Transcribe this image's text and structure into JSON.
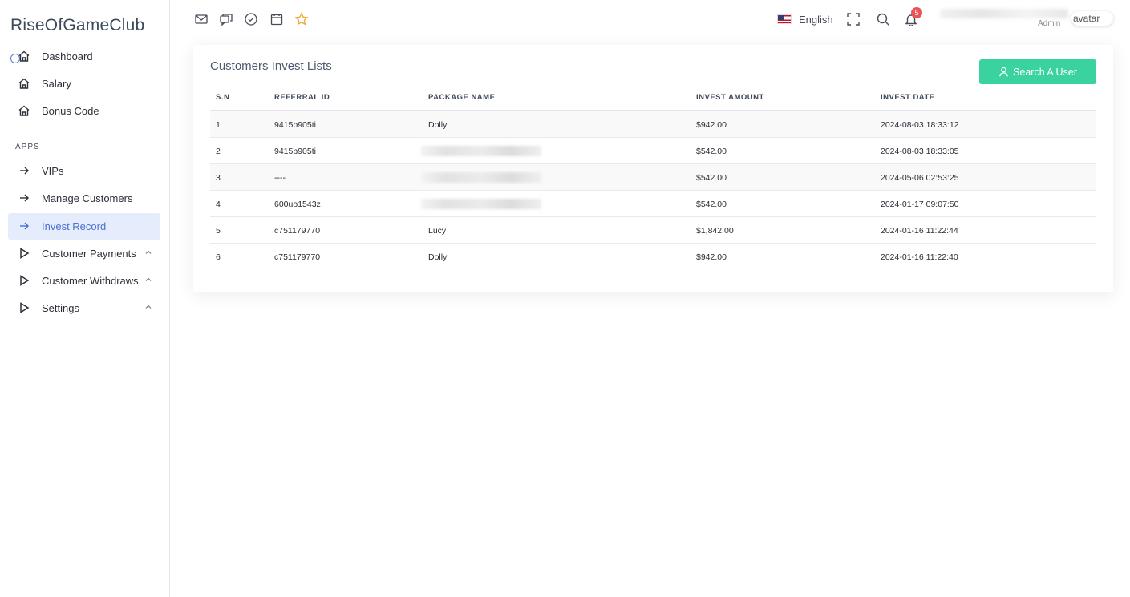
{
  "app": {
    "brand": "RiseOfGameClub"
  },
  "sidebar": {
    "section_label": "APPS",
    "items": [
      {
        "label": "Dashboard",
        "icon": "home-icon"
      },
      {
        "label": "Salary",
        "icon": "home-icon"
      },
      {
        "label": "Bonus Code",
        "icon": "home-icon"
      },
      {
        "label": "VIPs",
        "icon": "arrow-right-icon"
      },
      {
        "label": "Manage Customers",
        "icon": "arrow-right-icon"
      },
      {
        "label": "Invest Record",
        "icon": "arrow-right-icon",
        "active": true
      },
      {
        "label": "Customer Payments",
        "icon": "play-icon"
      },
      {
        "label": "Customer Withdraws",
        "icon": "play-icon"
      },
      {
        "label": "Settings",
        "icon": "play-icon"
      }
    ]
  },
  "header": {
    "language": "English",
    "notification_count": "5",
    "user_role": "Admin",
    "avatar_alt": "avatar"
  },
  "card": {
    "title": "Customers Invest Lists",
    "search_button": "Search A User",
    "columns": [
      "S.N",
      "REFERRAL ID",
      "PACKAGE NAME",
      "INVEST AMOUNT",
      "INVEST DATE"
    ],
    "rows": [
      {
        "sn": "1",
        "referral": "9415p905ti",
        "package": "Dolly",
        "amount": "$942.00",
        "date": "2024-08-03 18:33:12"
      },
      {
        "sn": "2",
        "referral": "9415p905ti",
        "package": "",
        "amount": "$542.00",
        "date": "2024-08-03 18:33:05"
      },
      {
        "sn": "3",
        "referral": "----",
        "package": "",
        "amount": "$542.00",
        "date": "2024-05-06 02:53:25"
      },
      {
        "sn": "4",
        "referral": "600uo1543z",
        "package": "",
        "amount": "$542.00",
        "date": "2024-01-17 09:07:50"
      },
      {
        "sn": "5",
        "referral": "c751179770",
        "package": "Lucy",
        "amount": "$1,842.00",
        "date": "2024-01-16 11:22:44"
      },
      {
        "sn": "6",
        "referral": "c751179770",
        "package": "Dolly",
        "amount": "$942.00",
        "date": "2024-01-16 11:22:40"
      }
    ]
  },
  "colors": {
    "accent": "#4b6fd1",
    "button": "#3ad29f",
    "badge": "#ea5455",
    "active_bg": "#e5ecfb"
  }
}
